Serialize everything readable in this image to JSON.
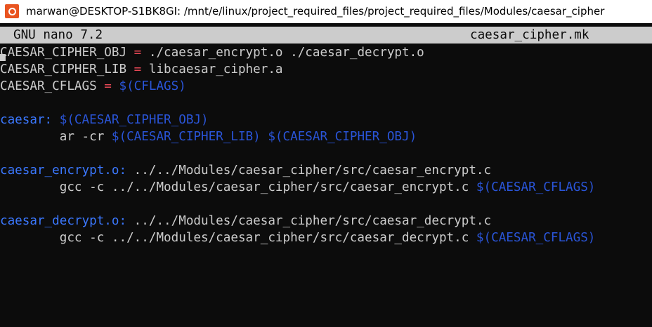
{
  "window": {
    "title": "marwan@DESKTOP-S1BK8GI: /mnt/e/linux/project_required_files/project_required_files/Modules/caesar_cipher",
    "icon": "ubuntu-icon"
  },
  "nano": {
    "version": "GNU nano 7.2",
    "filename": "caesar_cipher.mk"
  },
  "colors": {
    "background": "#0c0c0c",
    "text": "#cccccc",
    "target": "#3b78ff",
    "variable": "#2a55d9",
    "operator": "#e74856",
    "header_bg": "#cccccc"
  },
  "editor": {
    "lines": [
      {
        "tokens": [
          {
            "t": "CAESAR_CIPHER_OBJ ",
            "k": "plain"
          },
          {
            "t": "=",
            "k": "op"
          },
          {
            "t": " ./caesar_encrypt.o ./caesar_decrypt.o",
            "k": "plain"
          }
        ]
      },
      {
        "tokens": [
          {
            "t": "CAESAR_CIPHER_LIB ",
            "k": "plain"
          },
          {
            "t": "=",
            "k": "op"
          },
          {
            "t": " libcaesar_cipher.a",
            "k": "plain"
          }
        ]
      },
      {
        "tokens": [
          {
            "t": "CAESAR_CFLAGS ",
            "k": "plain"
          },
          {
            "t": "=",
            "k": "op"
          },
          {
            "t": " ",
            "k": "plain"
          },
          {
            "t": "$(CFLAGS)",
            "k": "var"
          }
        ]
      },
      {
        "tokens": []
      },
      {
        "tokens": [
          {
            "t": "caesar:",
            "k": "target"
          },
          {
            "t": " ",
            "k": "plain"
          },
          {
            "t": "$(CAESAR_CIPHER_OBJ)",
            "k": "var"
          }
        ]
      },
      {
        "tokens": [
          {
            "t": "        ar -cr ",
            "k": "plain"
          },
          {
            "t": "$(CAESAR_CIPHER_LIB)",
            "k": "var"
          },
          {
            "t": " ",
            "k": "plain"
          },
          {
            "t": "$(CAESAR_CIPHER_OBJ)",
            "k": "var"
          }
        ]
      },
      {
        "tokens": []
      },
      {
        "tokens": [
          {
            "t": "caesar_encrypt.o:",
            "k": "target"
          },
          {
            "t": " ../../Modules/caesar_cipher/src/caesar_encrypt.c",
            "k": "plain"
          }
        ]
      },
      {
        "tokens": [
          {
            "t": "        gcc -c ../../Modules/caesar_cipher/src/caesar_encrypt.c ",
            "k": "plain"
          },
          {
            "t": "$(CAESAR_CFLAGS)",
            "k": "var"
          }
        ]
      },
      {
        "tokens": []
      },
      {
        "tokens": [
          {
            "t": "caesar_decrypt.o:",
            "k": "target"
          },
          {
            "t": " ../../Modules/caesar_cipher/src/caesar_decrypt.c",
            "k": "plain"
          }
        ]
      },
      {
        "tokens": [
          {
            "t": "        gcc -c ../../Modules/caesar_cipher/src/caesar_decrypt.c ",
            "k": "plain"
          },
          {
            "t": "$(CAESAR_CFLAGS)",
            "k": "var"
          }
        ]
      }
    ]
  }
}
